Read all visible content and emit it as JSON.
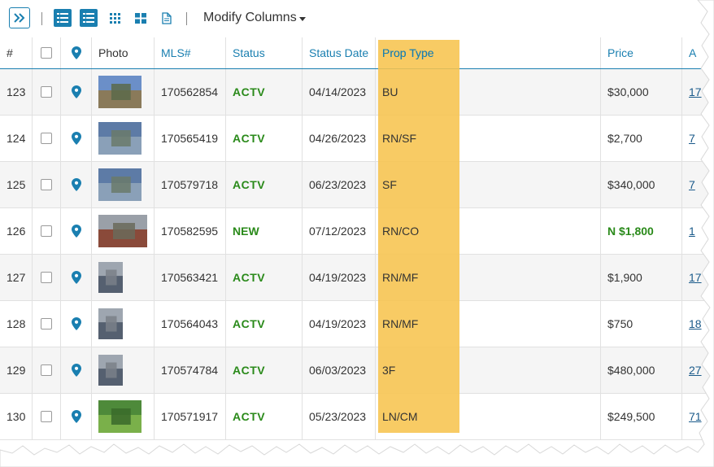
{
  "toolbar": {
    "expand_icon": "double-chevron-right-icon",
    "view_icons": [
      "list-view-icon",
      "detail-list-view-icon",
      "grid-view-icon",
      "tile-view-icon",
      "document-view-icon"
    ],
    "modify_columns_label": "Modify Columns"
  },
  "colors": {
    "accent": "#1a7fb0",
    "status_green": "#2a8a1a",
    "highlight": "#f7c44f"
  },
  "table": {
    "headers": {
      "num": "#",
      "photo": "Photo",
      "mls": "MLS#",
      "status": "Status",
      "status_date": "Status Date",
      "prop_type": "Prop Type",
      "price": "Price",
      "address": "A"
    },
    "rows": [
      {
        "num": "123",
        "mls": "170562854",
        "status": "ACTV",
        "status_date": "04/14/2023",
        "prop_type": "BU",
        "price": "$30,000",
        "addr": "17"
      },
      {
        "num": "124",
        "mls": "170565419",
        "status": "ACTV",
        "status_date": "04/26/2023",
        "prop_type": "RN/SF",
        "price": "$2,700",
        "addr": "7"
      },
      {
        "num": "125",
        "mls": "170579718",
        "status": "ACTV",
        "status_date": "06/23/2023",
        "prop_type": "SF",
        "price": "$340,000",
        "addr": "7"
      },
      {
        "num": "126",
        "mls": "170582595",
        "status": "NEW",
        "status_date": "07/12/2023",
        "prop_type": "RN/CO",
        "price": "N $1,800",
        "addr": "1"
      },
      {
        "num": "127",
        "mls": "170563421",
        "status": "ACTV",
        "status_date": "04/19/2023",
        "prop_type": "RN/MF",
        "price": "$1,900",
        "addr": "17"
      },
      {
        "num": "128",
        "mls": "170564043",
        "status": "ACTV",
        "status_date": "04/19/2023",
        "prop_type": "RN/MF",
        "price": "$750",
        "addr": "18"
      },
      {
        "num": "129",
        "mls": "170574784",
        "status": "ACTV",
        "status_date": "06/03/2023",
        "prop_type": "3F",
        "price": "$480,000",
        "addr": "27"
      },
      {
        "num": "130",
        "mls": "170571917",
        "status": "ACTV",
        "status_date": "05/23/2023",
        "prop_type": "LN/CM",
        "price": "$249,500",
        "addr": "71"
      }
    ]
  }
}
